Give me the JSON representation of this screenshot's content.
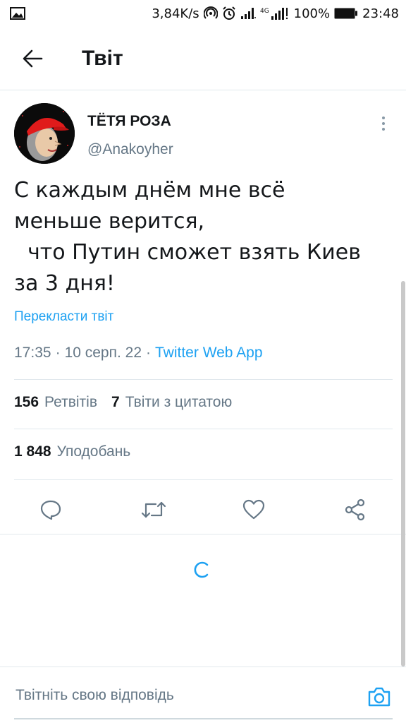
{
  "status_bar": {
    "speed": "3,84K/s",
    "battery_percent": "100%",
    "time": "23:48",
    "network": "4G",
    "icons": [
      "image-icon",
      "hotspot-icon",
      "alarm-icon",
      "signal-icon",
      "signal-4g-icon",
      "battery-icon"
    ]
  },
  "header": {
    "title": "Твіт"
  },
  "tweet": {
    "author_name": "ТЁТЯ РОЗА",
    "author_handle": "@Anakoyher",
    "text": "С каждым днём мне всё\nменьше верится,\n  что Путин сможет взять Киев\nза 3 дня!",
    "translate_label": "Перекласти твіт",
    "time": "17:35",
    "separator": "·",
    "date": "10 серп. 22",
    "source": "Twitter Web App"
  },
  "stats": {
    "retweets_count": "156",
    "retweets_label": "Ретвітів",
    "quotes_count": "7",
    "quotes_label": "Твіти з цитатою",
    "likes_count": "1 848",
    "likes_label": "Уподобань"
  },
  "reply": {
    "placeholder": "Твітніть свою відповідь"
  },
  "colors": {
    "accent": "#1da1f2",
    "text_primary": "#14171a",
    "text_secondary": "#657786",
    "divider": "#e1e8ed"
  }
}
